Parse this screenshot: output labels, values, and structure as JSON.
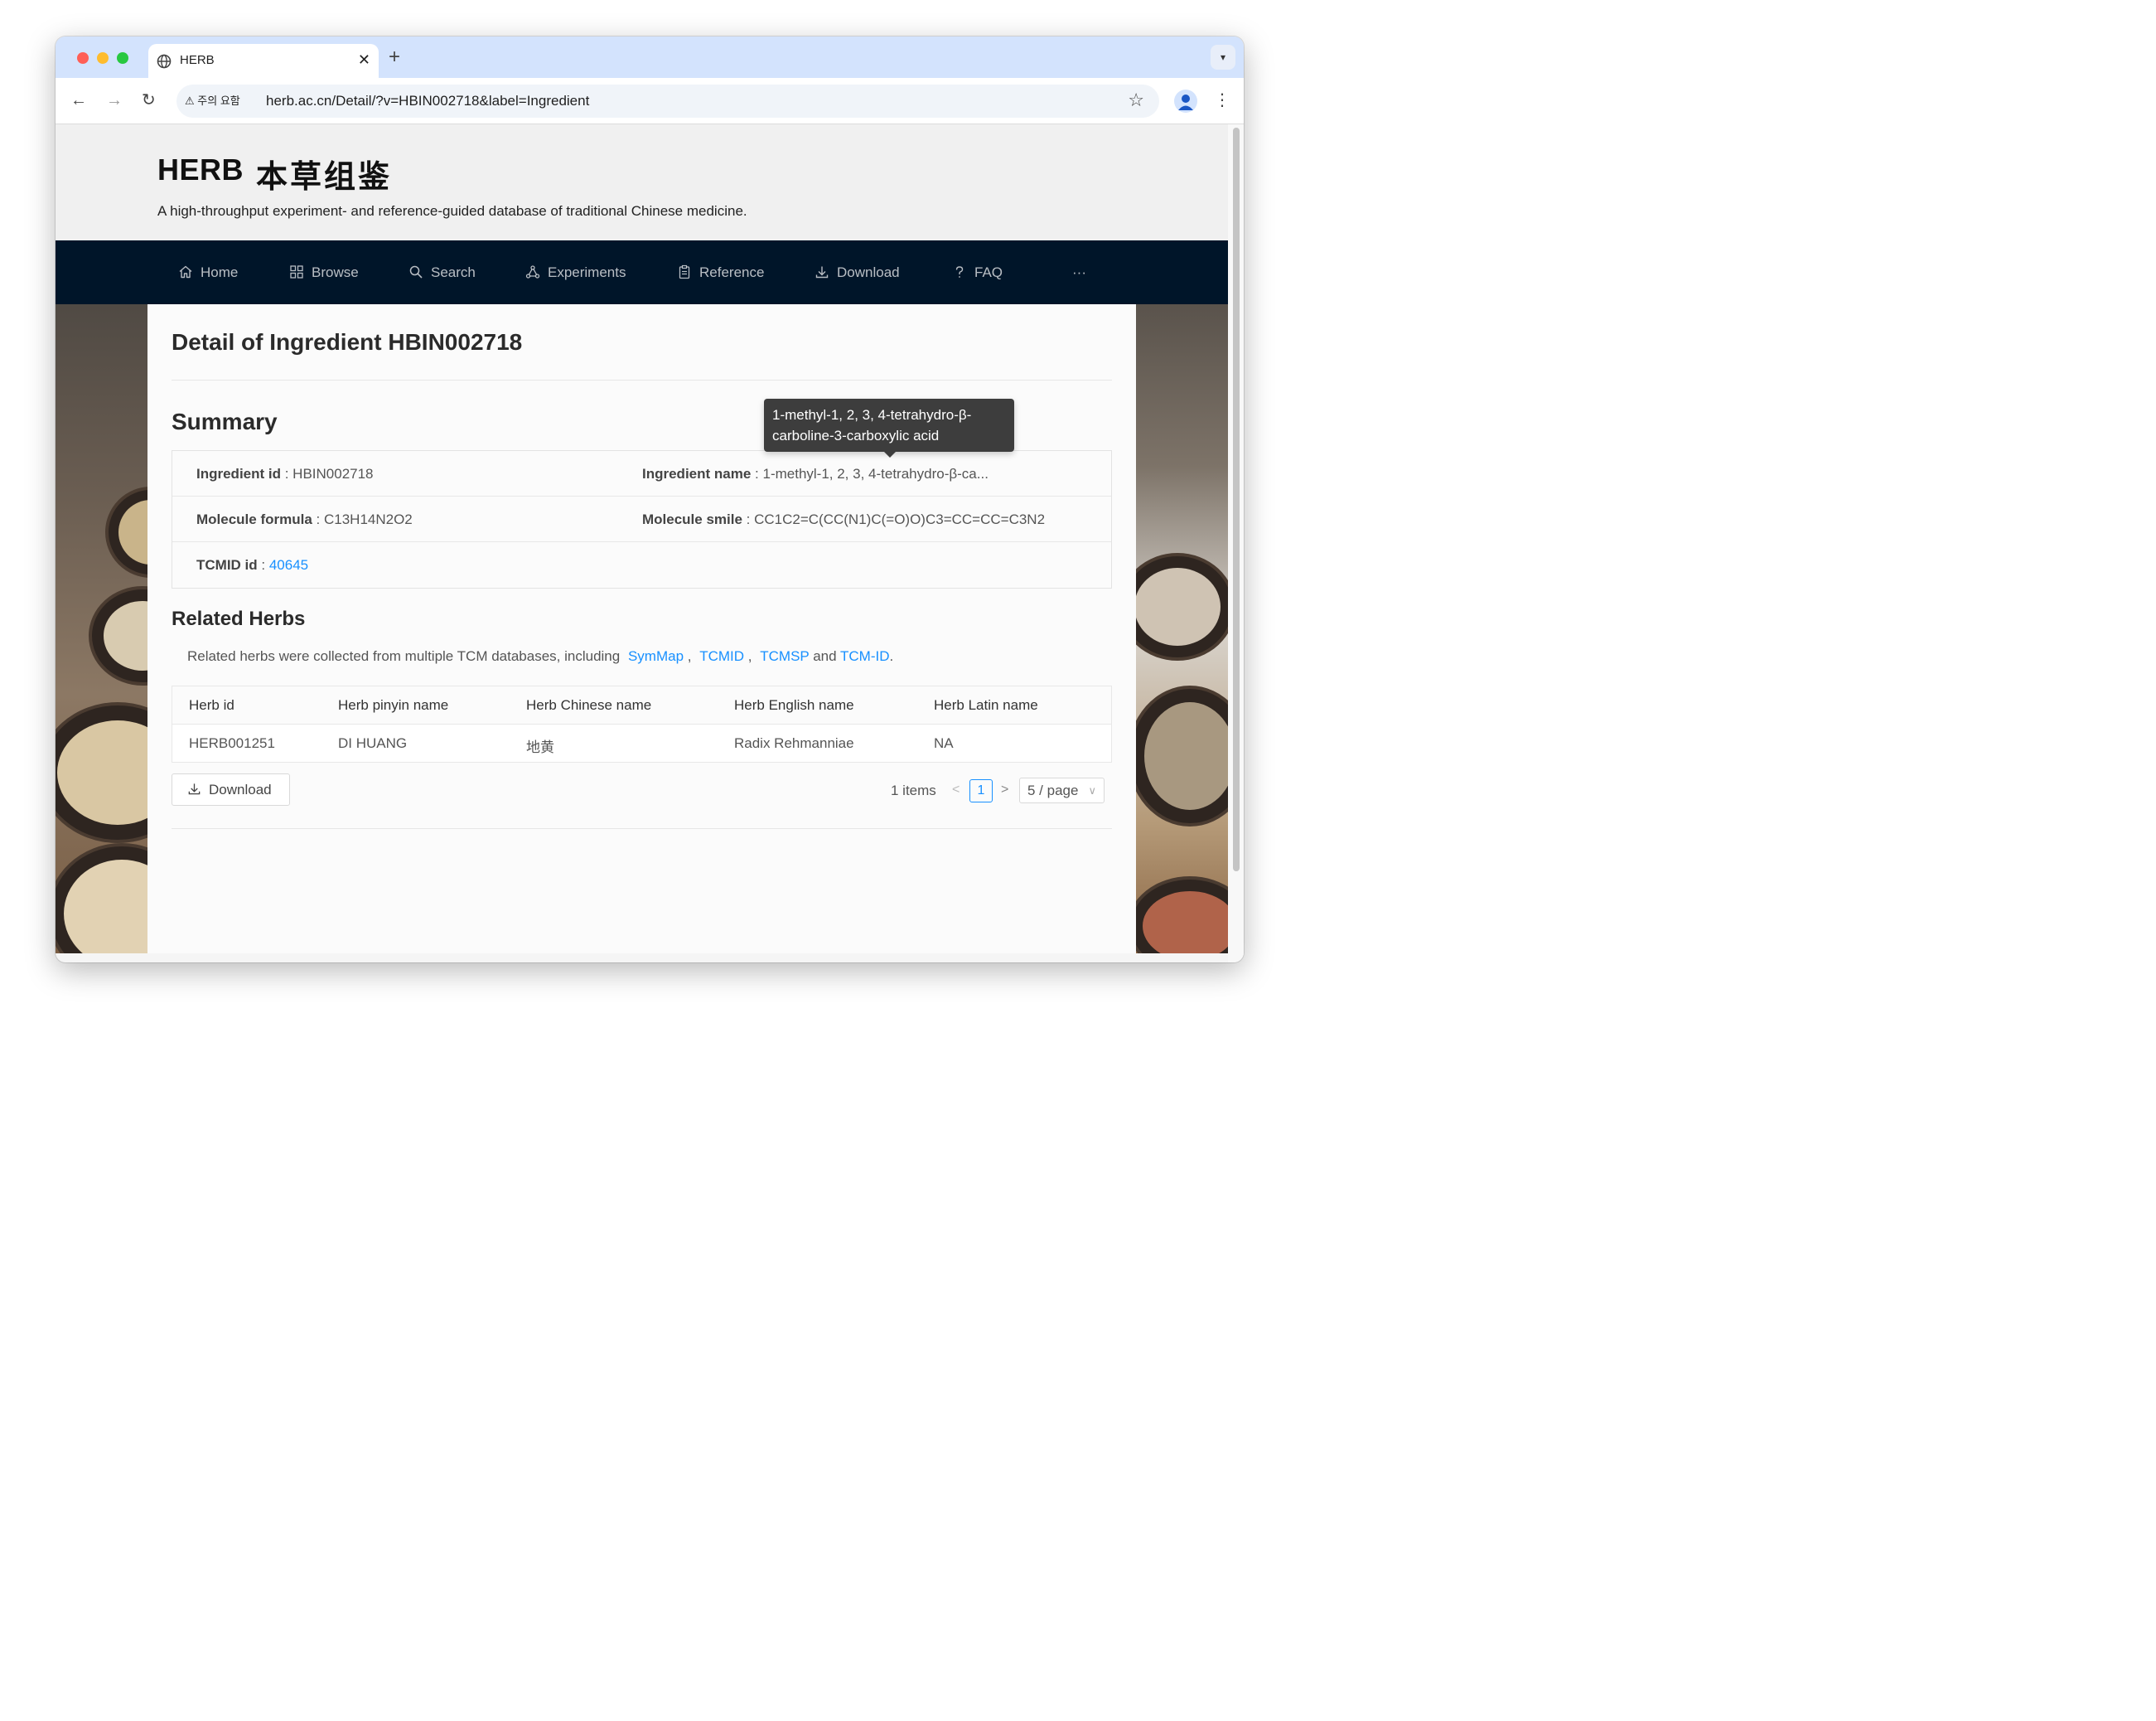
{
  "browser": {
    "tab_title": "HERB",
    "security_label": "주의 요함",
    "url": "herb.ac.cn/Detail/?v=HBIN002718&label=Ingredient",
    "traffic_lights": {
      "close": "#ff5f57",
      "minimize": "#febc2e",
      "zoom": "#28c840"
    }
  },
  "site": {
    "logo": "HERB",
    "logo_chinese": "本草组鉴",
    "tagline": "A high-throughput experiment- and reference-guided database of traditional Chinese medicine.",
    "menu": [
      {
        "label": "Home",
        "icon": "home-icon"
      },
      {
        "label": "Browse",
        "icon": "grid-icon"
      },
      {
        "label": "Search",
        "icon": "search-icon"
      },
      {
        "label": "Experiments",
        "icon": "experiment-icon"
      },
      {
        "label": "Reference",
        "icon": "reference-icon"
      },
      {
        "label": "Download",
        "icon": "download-icon"
      },
      {
        "label": "FAQ",
        "icon": "question-icon"
      }
    ],
    "menu_more": "···",
    "nav_color": "#001529",
    "link_color": "#1890ff"
  },
  "detail": {
    "title": "Detail of Ingredient HBIN002718",
    "summary_heading": "Summary",
    "fields": {
      "ingredient_id": {
        "label": "Ingredient id",
        "value": "HBIN002718"
      },
      "ingredient_name": {
        "label": "Ingredient name",
        "value": "1-methyl-1, 2, 3, 4-tetrahydro-β-ca..."
      },
      "molecule_formula": {
        "label": "Molecule formula",
        "value": "C13H14N2O2"
      },
      "molecule_smile": {
        "label": "Molecule smile",
        "value": "CC1C2=C(CC(N1)C(=O)O)C3=CC=CC=C3N2"
      },
      "tcmid_id": {
        "label": "TCMID id",
        "value": "40645"
      }
    },
    "separator": " : ",
    "tooltip": "1-methyl-1, 2, 3, 4-tetrahydro-β-carboline-3-carboxylic acid"
  },
  "related": {
    "heading": "Related Herbs",
    "desc_prefix": "Related herbs were collected from multiple TCM databases, including",
    "sources": [
      "SymMap",
      "TCMID",
      "TCMSP",
      "TCM-ID"
    ],
    "comma": ",",
    "and": "and",
    "period": ".",
    "columns": [
      "Herb id",
      "Herb pinyin name",
      "Herb Chinese name",
      "Herb English name",
      "Herb Latin name"
    ],
    "rows": [
      [
        "HERB001251",
        "DI HUANG",
        "地黄",
        "Radix Rehmanniae",
        "NA"
      ]
    ],
    "download_label": "Download",
    "pagination": {
      "total": "1 items",
      "prev": "<",
      "current": "1",
      "next": ">",
      "page_size": "5 / page",
      "caret": "∨"
    }
  }
}
